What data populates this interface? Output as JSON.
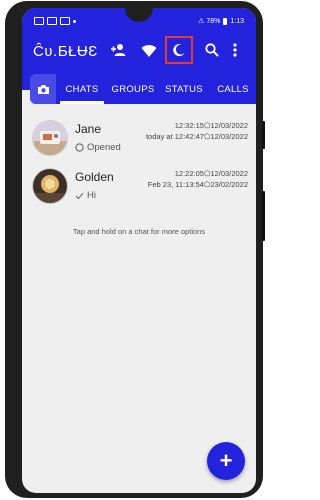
{
  "status_bar": {
    "left_icons": [
      "square-icon",
      "square-icon",
      "square-icon",
      "dot-icon"
    ],
    "right_text": "⚠ 78%",
    "time": "1:13"
  },
  "toolbar": {
    "title": "Ĉʋ.ƂŁɄƐ",
    "icons": [
      "add-contact-icon",
      "wifi-icon",
      "night-mode-icon",
      "search-icon",
      "more-vert-icon"
    ]
  },
  "tabs": [
    {
      "label": "CHATS",
      "active": true
    },
    {
      "label": "GROUPS",
      "active": false
    },
    {
      "label": "STATUS",
      "active": false
    },
    {
      "label": "CALLS",
      "active": false
    }
  ],
  "chats": [
    {
      "name": "Jane",
      "preview": "Opened",
      "preview_icon": "opened-circle-icon",
      "time_line1": "12:32:15⬠12/03/2022",
      "time_line2": "today at 12:42:47⬠12/03/2022"
    },
    {
      "name": "Golden",
      "preview": "Hi",
      "preview_icon": "check-icon",
      "time_line1": "12:22:05⬠12/03/2022",
      "time_line2": "Feb 23, 11:13:54⬠23/02/2022"
    }
  ],
  "hint": "Tap and hold on a chat for more options",
  "fab": {
    "label": "+"
  },
  "colors": {
    "primary": "#2323dd",
    "background": "#efefef",
    "highlight": "#e53935"
  }
}
